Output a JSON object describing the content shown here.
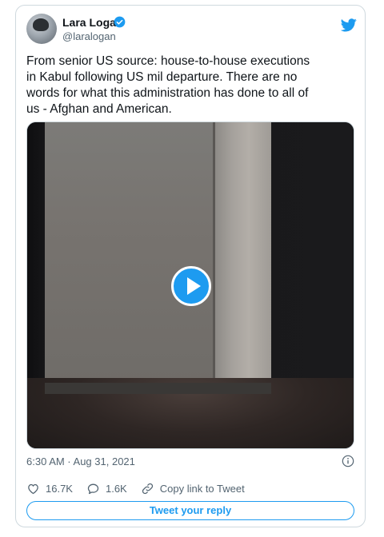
{
  "author": {
    "name": "Lara Logan",
    "handle": "@laralogan",
    "verified": true
  },
  "tweet": {
    "text": "From senior US source: house-to-house executions\nin Kabul following US mil departure. There are no\nwords for what this administration has done to all of\nus - Afghan and American.",
    "timestamp": "6:30 AM · Aug 31, 2021"
  },
  "media": {
    "type": "video",
    "play_icon": "play-icon"
  },
  "stats": {
    "likes": "16.7K",
    "replies": "1.6K",
    "copy_link_label": "Copy link to Tweet"
  },
  "reply_button_label": "Tweet your reply",
  "colors": {
    "accent": "#1d9bf0",
    "muted": "#536471",
    "border": "#cfd9de"
  }
}
